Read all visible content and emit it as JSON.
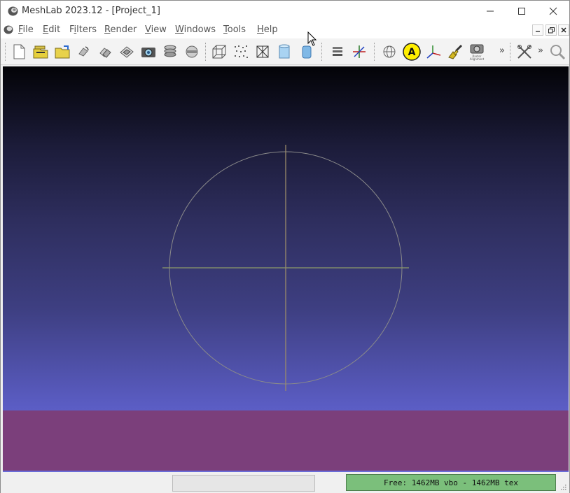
{
  "window": {
    "title": "MeshLab 2023.12 - [Project_1]"
  },
  "menu": {
    "items": [
      {
        "label": "File",
        "accel": "F"
      },
      {
        "label": "Edit",
        "accel": "E"
      },
      {
        "label": "Filters",
        "accel": "i"
      },
      {
        "label": "Render",
        "accel": "R"
      },
      {
        "label": "View",
        "accel": "V"
      },
      {
        "label": "Windows",
        "accel": "W"
      },
      {
        "label": "Tools",
        "accel": "T"
      },
      {
        "label": "Help",
        "accel": "H"
      }
    ]
  },
  "toolbar": {
    "icons": [
      "new-project-icon",
      "open-project-icon",
      "import-mesh-icon",
      "reload-icon",
      "reload-all-icon",
      "export-mesh-icon",
      "snapshot-icon",
      "layers-icon",
      "raster-icon",
      "bounding-box-icon",
      "points-icon",
      "wireframe-icon",
      "flat-shading-icon",
      "smooth-shading-icon",
      "layer-dialog-icon",
      "axes-trackball-icon",
      "globe-icon",
      "annotation-a-icon",
      "axes-icon",
      "select-color-icon",
      "raster-alignment-icon",
      "tools-icon",
      "zoom-icon"
    ],
    "raster_label": "Raster Alignment",
    "annotation_letter": "A",
    "more": "»"
  },
  "status": {
    "memory": "Free: 1462MB vbo - 1462MB tex"
  },
  "colors": {
    "floor": "#7b3f7b",
    "memory_bg": "#7bbf7b",
    "trackball": "#8a8a8a",
    "axis_h": "#8c9a6a",
    "axis_v": "#9a8a6a"
  }
}
